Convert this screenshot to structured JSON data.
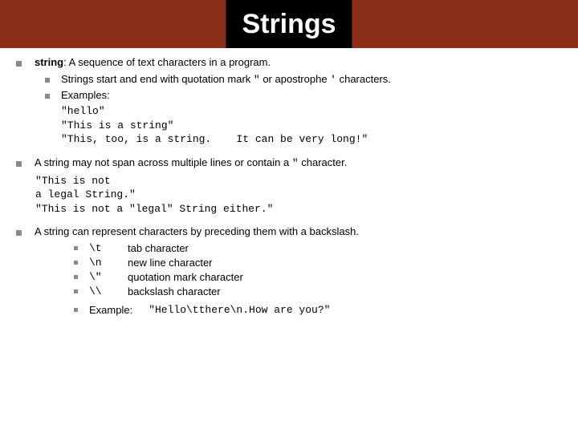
{
  "header": {
    "title": "Strings"
  },
  "s1": {
    "line_prefix": "string",
    "line_rest": ": A sequence of text characters in a program.",
    "sub1_a": "Strings start and end with quotation mark ",
    "sub1_q": "\"",
    "sub1_b": " or apostrophe ",
    "sub1_ap": "'",
    "sub1_c": " characters.",
    "sub2": "Examples:",
    "code": "\"hello\"\n\"This is a string\"\n\"This, too, is a string.    It can be very long!\""
  },
  "s2": {
    "line_a": "A string may not span across multiple lines or contain a ",
    "line_q": "\"",
    "line_b": " character.",
    "code": "\"This is not\na legal String.\"\n\"This is not a \"legal\" String either.\""
  },
  "s3": {
    "line": "A string can represent characters by preceding them with a backslash.",
    "escapes": [
      {
        "code": "\\t",
        "desc": "tab character"
      },
      {
        "code": "\\n",
        "desc": "new line character"
      },
      {
        "code": "\\\"",
        "desc": "quotation mark character"
      },
      {
        "code": "\\\\",
        "desc": "backslash character"
      }
    ],
    "example_label": "Example:",
    "example_code": "\"Hello\\tthere\\n.How are you?\""
  }
}
